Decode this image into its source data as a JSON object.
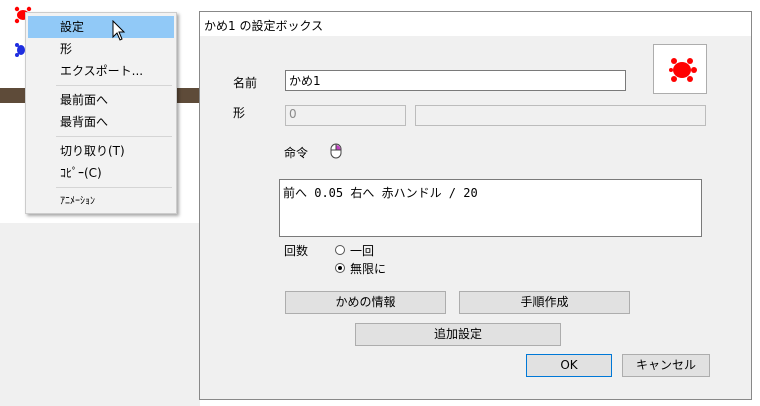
{
  "context_menu": {
    "items": [
      "設定",
      "形",
      "エクスポート...",
      "最前面へ",
      "最背面へ",
      "切り取り(T)",
      "ｺﾋﾟｰ(C)",
      "ｱﾆﾒｰｼｮﾝ"
    ],
    "highlighted_index": 0
  },
  "dialog": {
    "title": "かめ1 の設定ボックス",
    "name_label": "名前",
    "name_value": "かめ1",
    "shape_label": "形",
    "shape_value": "0",
    "command_label": "命令",
    "command_text": "前へ 0.05 右へ 赤ハンドル / 20",
    "count_label": "回数",
    "radio_once": "一回",
    "radio_infinite": "無限に",
    "selected_radio": "無限に",
    "btn_info": "かめの情報",
    "btn_procedure": "手順作成",
    "btn_additional": "追加設定",
    "btn_ok": "OK",
    "btn_cancel": "キャンセル"
  },
  "colors": {
    "turtle_red": "#ff0000",
    "turtle_blue": "#1f2ee0",
    "menu_highlight": "#91c9f7",
    "strip": "#5e4b39"
  }
}
